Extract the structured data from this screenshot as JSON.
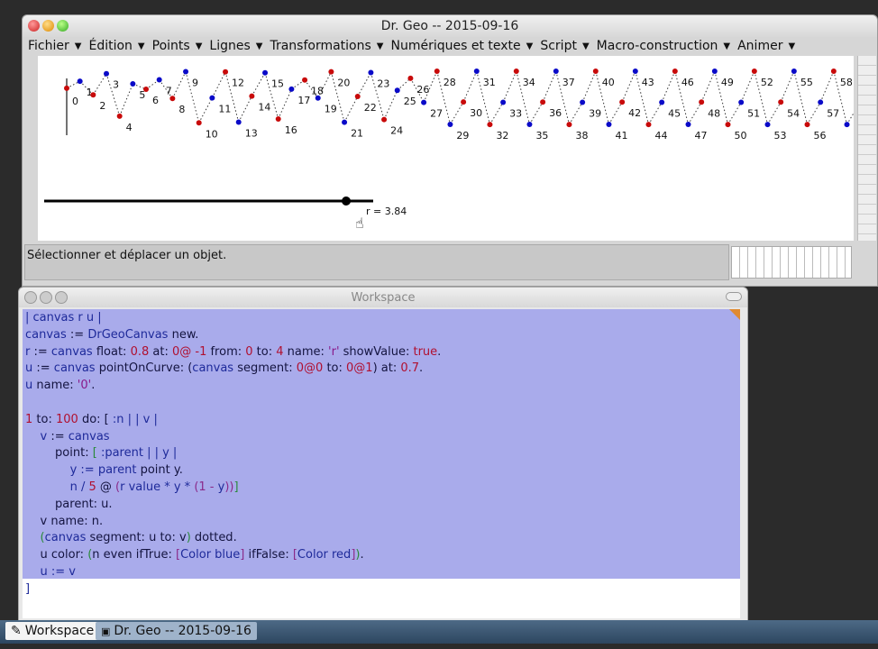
{
  "drgeo_window": {
    "title": "Dr. Geo --  2015-09-16",
    "menus": [
      "Fichier",
      "Édition",
      "Points",
      "Lignes",
      "Transformations",
      "Numériques et texte",
      "Script",
      "Macro-construction",
      "Animer"
    ],
    "status": "Sélectionner et déplacer un objet.",
    "slider": {
      "name": "r",
      "value": 3.84,
      "min": 0,
      "max": 4,
      "label": "r = 3.84"
    },
    "sequence": {
      "initial_value": 0.7,
      "r": 3.84,
      "count": 61,
      "even_color": "#0a0ac8",
      "odd_color": "#c80a0a"
    }
  },
  "workspace_window": {
    "title": "Workspace",
    "code_lines": [
      [
        [
          "| canvas r u |",
          "v"
        ]
      ],
      [
        [
          "canvas",
          "v"
        ],
        [
          " := ",
          "m"
        ],
        [
          "DrGeoCanvas",
          "v"
        ],
        [
          " new.",
          "m"
        ]
      ],
      [
        [
          "r",
          "v"
        ],
        [
          " := ",
          "m"
        ],
        [
          "canvas",
          "v"
        ],
        [
          " float: ",
          "m"
        ],
        [
          "0.8",
          "n"
        ],
        [
          " at: ",
          "m"
        ],
        [
          "0@ -1",
          "n"
        ],
        [
          " from: ",
          "m"
        ],
        [
          "0",
          "n"
        ],
        [
          " to: ",
          "m"
        ],
        [
          "4",
          "n"
        ],
        [
          " name: ",
          "m"
        ],
        [
          "'r'",
          "s"
        ],
        [
          " showValue: ",
          "m"
        ],
        [
          "true",
          "n"
        ],
        [
          ".",
          "m"
        ]
      ],
      [
        [
          "u",
          "v"
        ],
        [
          " := ",
          "m"
        ],
        [
          "canvas",
          "v"
        ],
        [
          " pointOnCurve: (",
          "m"
        ],
        [
          "canvas",
          "v"
        ],
        [
          " segment: ",
          "m"
        ],
        [
          "0@0",
          "n"
        ],
        [
          " to: ",
          "m"
        ],
        [
          "0@1",
          "n"
        ],
        [
          ") at: ",
          "m"
        ],
        [
          "0.7",
          "n"
        ],
        [
          ".",
          "m"
        ]
      ],
      [
        [
          "u",
          "v"
        ],
        [
          " name: ",
          "m"
        ],
        [
          "'0'",
          "s"
        ],
        [
          ".",
          "m"
        ]
      ],
      [],
      [
        [
          "1",
          "n"
        ],
        [
          " to: ",
          "m"
        ],
        [
          "100",
          "n"
        ],
        [
          " do: [ ",
          "m"
        ],
        [
          ":n | | v |",
          "v"
        ]
      ],
      [
        [
          "    v",
          "v"
        ],
        [
          " := ",
          "m"
        ],
        [
          "canvas",
          "v"
        ]
      ],
      [
        [
          "        point: ",
          "m"
        ],
        [
          "[ ",
          "g"
        ],
        [
          ":parent | | y |",
          "v"
        ]
      ],
      [
        [
          "            y",
          "v"
        ],
        [
          " := ",
          "v"
        ],
        [
          "parent",
          "v"
        ],
        [
          " point y.",
          "m"
        ]
      ],
      [
        [
          "            n / ",
          "v"
        ],
        [
          "5",
          "n"
        ],
        [
          " @ ",
          "m"
        ],
        [
          "(",
          "p"
        ],
        [
          "r value * y * ",
          "v"
        ],
        [
          "(1 - ",
          "p"
        ],
        [
          "y",
          "v"
        ],
        [
          "))",
          "p"
        ],
        [
          "]",
          "g"
        ]
      ],
      [
        [
          "        parent: u.",
          "m"
        ]
      ],
      [
        [
          "    v name: n.",
          "m"
        ]
      ],
      [
        [
          "    (",
          "g"
        ],
        [
          "canvas",
          "v"
        ],
        [
          " segment: u to: v",
          "m"
        ],
        [
          ")",
          "g"
        ],
        [
          " dotted.",
          "m"
        ]
      ],
      [
        [
          "    u color: ",
          "m"
        ],
        [
          "(",
          "g"
        ],
        [
          "n even ifTrue: ",
          "m"
        ],
        [
          "[",
          "p"
        ],
        [
          "Color blue",
          "v"
        ],
        [
          "]",
          "p"
        ],
        [
          " ifFalse: ",
          "m"
        ],
        [
          "[",
          "p"
        ],
        [
          "Color red",
          "v"
        ],
        [
          "]",
          "p"
        ],
        [
          ")",
          "g"
        ],
        [
          ".",
          "m"
        ]
      ],
      [
        [
          "    u := v",
          "v"
        ]
      ],
      [
        [
          "]",
          "v"
        ]
      ]
    ],
    "token_colors": {
      "v": "#1e2a9a",
      "m": "#141440",
      "n": "#b01030",
      "s": "#8a1a8a",
      "g": "#2a8a3a",
      "p": "#8a2a8a"
    }
  },
  "taskbar": {
    "items": [
      "Workspace",
      "Dr. Geo --  2015-09-16"
    ]
  }
}
